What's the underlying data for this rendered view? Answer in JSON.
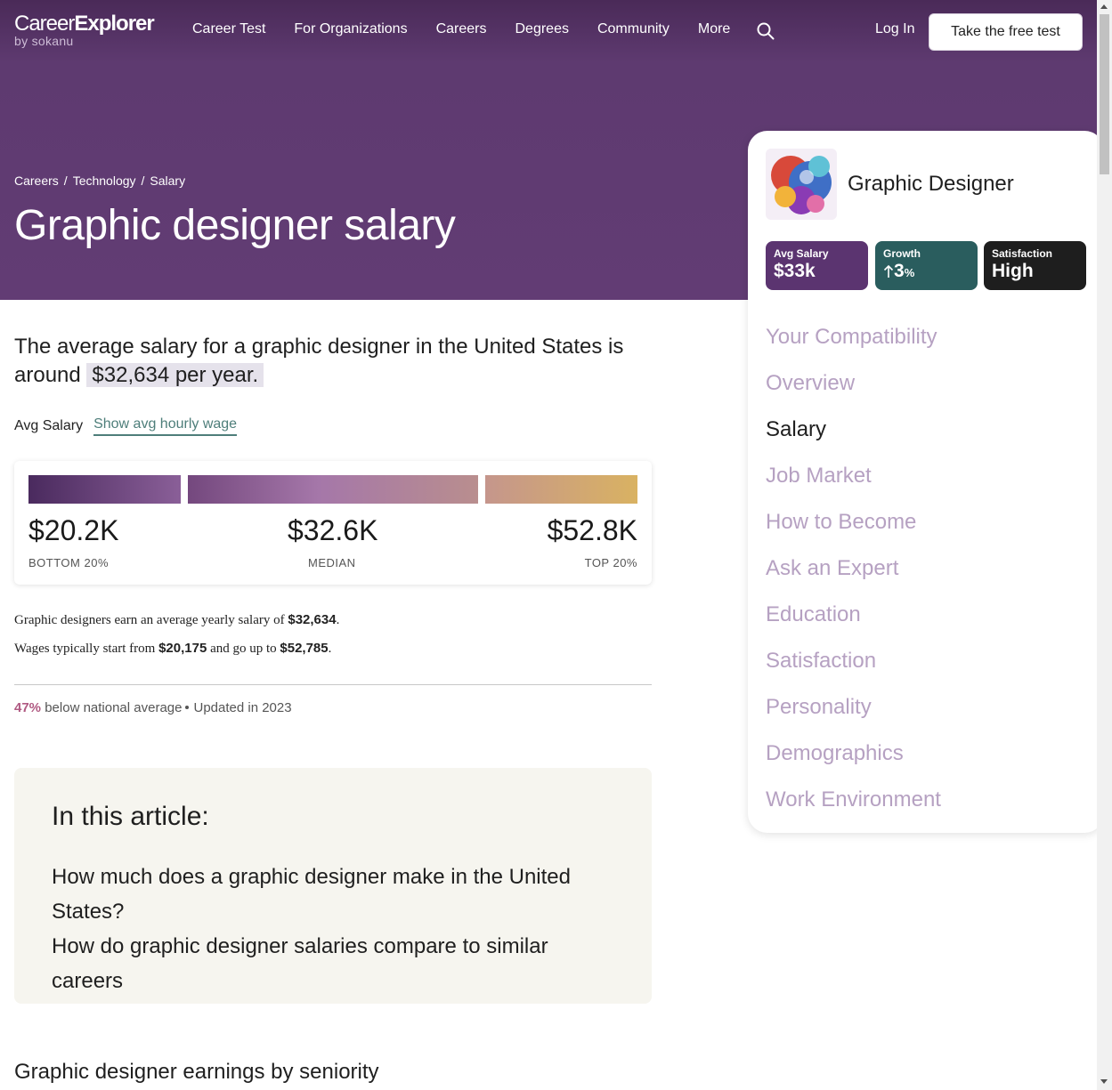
{
  "nav": {
    "logo_main_a": "Career",
    "logo_main_b": "Explorer",
    "logo_sub": "by sokanu",
    "links": [
      "Career Test",
      "For Organizations",
      "Careers",
      "Degrees",
      "Community",
      "More"
    ],
    "login": "Log In",
    "cta": "Take the free test"
  },
  "breadcrumb": [
    "Careers",
    "Technology",
    "Salary"
  ],
  "page_title": "Graphic designer salary",
  "lead": {
    "text": "The average salary for a graphic designer in the United States is around",
    "highlight": "$32,634 per year."
  },
  "toggle": {
    "label": "Avg Salary",
    "link": "Show avg hourly wage"
  },
  "range": {
    "low_value": "$20.2K",
    "low_caption": "BOTTOM 20%",
    "mid_value": "$32.6K",
    "mid_caption": "MEDIAN",
    "high_value": "$52.8K",
    "high_caption": "TOP 20%"
  },
  "details": {
    "line1_a": "Graphic designers earn an average yearly salary of",
    "line1_b": "$32,634",
    "line1_c": ".",
    "line2_a": "Wages typically start from",
    "line2_b": "$20,175",
    "line2_c": "and go up to",
    "line2_d": "$52,785",
    "line2_e": "."
  },
  "meta": {
    "pct": "47%",
    "below": "below national average",
    "updated": "Updated in 2023"
  },
  "toc": {
    "title": "In this article:",
    "items": [
      "How much does a graphic designer make in the United States?",
      "How do graphic designer salaries compare to similar careers"
    ]
  },
  "sub_heading": "Graphic designer earnings by seniority",
  "side": {
    "title": "Graphic Designer",
    "stats": {
      "salary_label": "Avg Salary",
      "salary_value": "$33k",
      "growth_label": "Growth",
      "growth_value": "3",
      "growth_unit": "%",
      "satisfaction_label": "Satisfaction",
      "satisfaction_value": "High"
    },
    "nav": [
      "Your Compatibility",
      "Overview",
      "Salary",
      "Job Market",
      "How to Become",
      "Ask an Expert",
      "Education",
      "Satisfaction",
      "Personality",
      "Demographics",
      "Work Environment"
    ],
    "active_index": 2
  },
  "colors": {
    "hero": "#623c74",
    "accent_pink": "#b05a82",
    "link_teal": "#4e7e7a",
    "side_inactive": "#b6a1c2"
  }
}
